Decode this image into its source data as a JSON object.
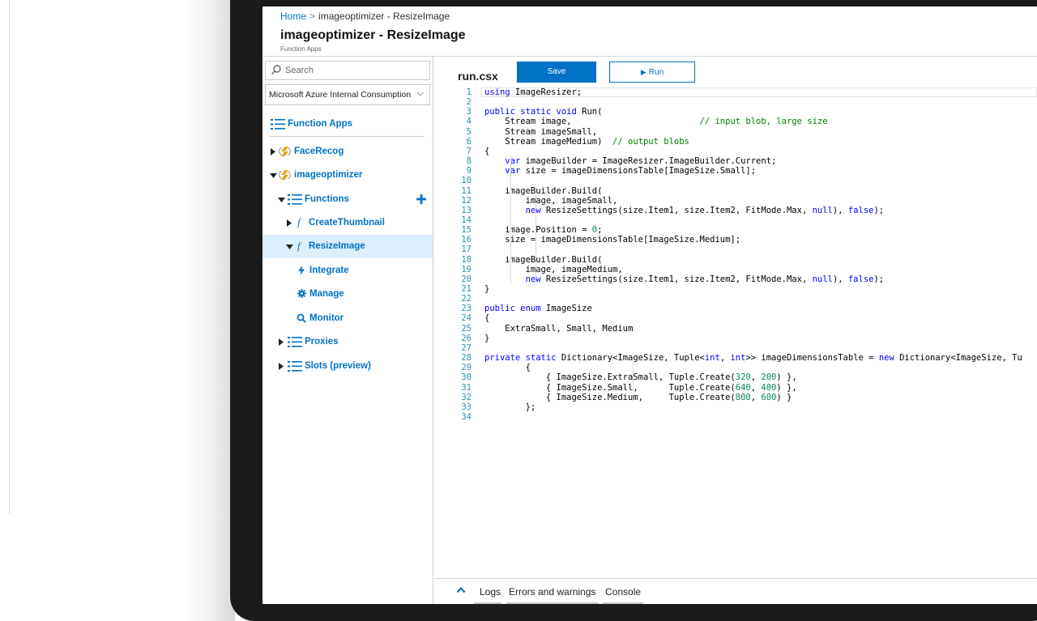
{
  "breadcrumb": {
    "home": "Home",
    "separator": ">",
    "current": "imageoptimizer - ResizeImage"
  },
  "header": {
    "title": "imageoptimizer - ResizeImage",
    "subtitle": "Function Apps"
  },
  "sidebar": {
    "search_placeholder": "Search",
    "subscription": "Microsoft Azure Internal Consumption",
    "function_apps": "Function Apps",
    "items": {
      "facerecog": "FaceRecog",
      "imageoptimizer": "imageoptimizer",
      "functions": "Functions",
      "createthumbnail": "CreateThumbnail",
      "resizeimage": "ResizeImage",
      "integrate": "Integrate",
      "manage": "Manage",
      "monitor": "Monitor",
      "proxies": "Proxies",
      "slots": "Slots (preview)"
    }
  },
  "editor": {
    "file_name": "run.csx",
    "save_label": "Save",
    "run_label": "Run",
    "lines": [
      [
        [
          "kw",
          "using"
        ],
        [
          "tx",
          " ImageResizer;"
        ]
      ],
      [],
      [
        [
          "kw",
          "public static void"
        ],
        [
          "tx",
          " Run("
        ]
      ],
      [
        [
          "tx",
          "    Stream image,                         "
        ],
        [
          "cm",
          "// input blob, large size"
        ]
      ],
      [
        [
          "tx",
          "    Stream imageSmall,"
        ]
      ],
      [
        [
          "tx",
          "    Stream imageMedium)  "
        ],
        [
          "cm",
          "// output blobs"
        ]
      ],
      [
        [
          "tx",
          "{"
        ]
      ],
      [
        [
          "tx",
          "    "
        ],
        [
          "kw",
          "var"
        ],
        [
          "tx",
          " imageBuilder = ImageResizer.ImageBuilder.Current;"
        ]
      ],
      [
        [
          "tx",
          "    "
        ],
        [
          "kw",
          "var"
        ],
        [
          "tx",
          " size = imageDimensionsTable[ImageSize.Small];"
        ]
      ],
      [],
      [
        [
          "tx",
          "    imageBuilder.Build("
        ]
      ],
      [
        [
          "tx",
          "        image, imageSmall,"
        ]
      ],
      [
        [
          "tx",
          "        "
        ],
        [
          "kw",
          "new"
        ],
        [
          "tx",
          " ResizeSettings(size.Item1, size.Item2, FitMode.Max, "
        ],
        [
          "kw",
          "null"
        ],
        [
          "tx",
          "), "
        ],
        [
          "kw",
          "false"
        ],
        [
          "tx",
          ");"
        ]
      ],
      [],
      [
        [
          "tx",
          "    image.Position = "
        ],
        [
          "nm",
          "0"
        ],
        [
          "tx",
          ";"
        ]
      ],
      [
        [
          "tx",
          "    size = imageDimensionsTable[ImageSize.Medium];"
        ]
      ],
      [],
      [
        [
          "tx",
          "    imageBuilder.Build("
        ]
      ],
      [
        [
          "tx",
          "        image, imageMedium,"
        ]
      ],
      [
        [
          "tx",
          "        "
        ],
        [
          "kw",
          "new"
        ],
        [
          "tx",
          " ResizeSettings(size.Item1, size.Item2, FitMode.Max, "
        ],
        [
          "kw",
          "null"
        ],
        [
          "tx",
          "), "
        ],
        [
          "kw",
          "false"
        ],
        [
          "tx",
          ");"
        ]
      ],
      [
        [
          "tx",
          "}"
        ]
      ],
      [],
      [
        [
          "kw",
          "public enum"
        ],
        [
          "tx",
          " ImageSize"
        ]
      ],
      [
        [
          "tx",
          "{"
        ]
      ],
      [
        [
          "tx",
          "    ExtraSmall, Small, Medium"
        ]
      ],
      [
        [
          "tx",
          "}"
        ]
      ],
      [],
      [
        [
          "kw",
          "private static"
        ],
        [
          "tx",
          " Dictionary<ImageSize, Tuple<"
        ],
        [
          "kw",
          "int"
        ],
        [
          "tx",
          ", "
        ],
        [
          "kw",
          "int"
        ],
        [
          "tx",
          ">> imageDimensionsTable = "
        ],
        [
          "kw",
          "new"
        ],
        [
          "tx",
          " Dictionary<ImageSize, Tu"
        ]
      ],
      [
        [
          "tx",
          "        {"
        ]
      ],
      [
        [
          "tx",
          "            { ImageSize.ExtraSmall, Tuple.Create("
        ],
        [
          "nm",
          "320"
        ],
        [
          "tx",
          ", "
        ],
        [
          "nm",
          "200"
        ],
        [
          "tx",
          ") },"
        ]
      ],
      [
        [
          "tx",
          "            { ImageSize.Small,      Tuple.Create("
        ],
        [
          "nm",
          "640"
        ],
        [
          "tx",
          ", "
        ],
        [
          "nm",
          "400"
        ],
        [
          "tx",
          ") },"
        ]
      ],
      [
        [
          "tx",
          "            { ImageSize.Medium,     Tuple.Create("
        ],
        [
          "nm",
          "800"
        ],
        [
          "tx",
          ", "
        ],
        [
          "nm",
          "600"
        ],
        [
          "tx",
          ") }"
        ]
      ],
      [
        [
          "tx",
          "        };"
        ]
      ],
      []
    ]
  },
  "bottom": {
    "logs": "Logs",
    "errors": "Errors and warnings",
    "console": "Console"
  },
  "colors": {
    "accent": "#0072c6",
    "selected_bg": "#dceefc",
    "keyword": "#0000ff",
    "comment": "#008000",
    "number": "#09885a",
    "line_number": "#2b91af"
  },
  "icons": [
    "search-icon",
    "chevron-down-icon",
    "list-icon",
    "caret-right-icon",
    "caret-down-icon",
    "lightning-bolt-icon",
    "function-icon",
    "plus-icon",
    "gear-icon",
    "search-monitor-icon",
    "play-icon",
    "chevron-up-icon"
  ]
}
